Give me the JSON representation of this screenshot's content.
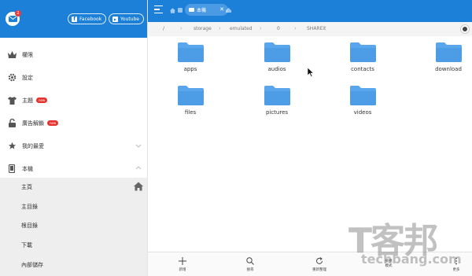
{
  "header": {
    "mail_badge": "2",
    "facebook_label": "Facebook",
    "youtube_label": "Youtube"
  },
  "sidebar": {
    "items": [
      {
        "label": "權限",
        "icon": "crown-icon"
      },
      {
        "label": "設定",
        "icon": "gear-icon"
      },
      {
        "label": "主題",
        "icon": "shirt-icon",
        "badge": "new"
      },
      {
        "label": "廣告解鎖",
        "icon": "lock-icon",
        "badge": "new"
      },
      {
        "label": "我的最愛",
        "icon": "star-icon",
        "expanded": false
      },
      {
        "label": "本機",
        "icon": "phone-icon",
        "expanded": true
      }
    ],
    "sub_items": [
      {
        "label": "主頁"
      },
      {
        "label": "主目錄"
      },
      {
        "label": "根目錄"
      },
      {
        "label": "下載"
      },
      {
        "label": "內部儲存"
      }
    ]
  },
  "topbar": {
    "tab_label": "本機",
    "tab_close": "✕"
  },
  "breadcrumb": [
    "/",
    "storage",
    "emulated",
    "0",
    "SHAREit"
  ],
  "folders": [
    "apps",
    "audios",
    "contacts",
    "download",
    "files",
    "pictures",
    "videos"
  ],
  "bottombar": {
    "new_label": "新增",
    "search_label": "搜尋",
    "refresh_label": "重新整理",
    "view_label": "檢視\n模式",
    "more_label": "更多"
  },
  "watermark": {
    "cjk": "T客邦",
    "url": "techbang.com"
  },
  "colors": {
    "accent": "#1c7fd8",
    "folder": "#5aa6ec",
    "badge_red": "#e5322d"
  }
}
